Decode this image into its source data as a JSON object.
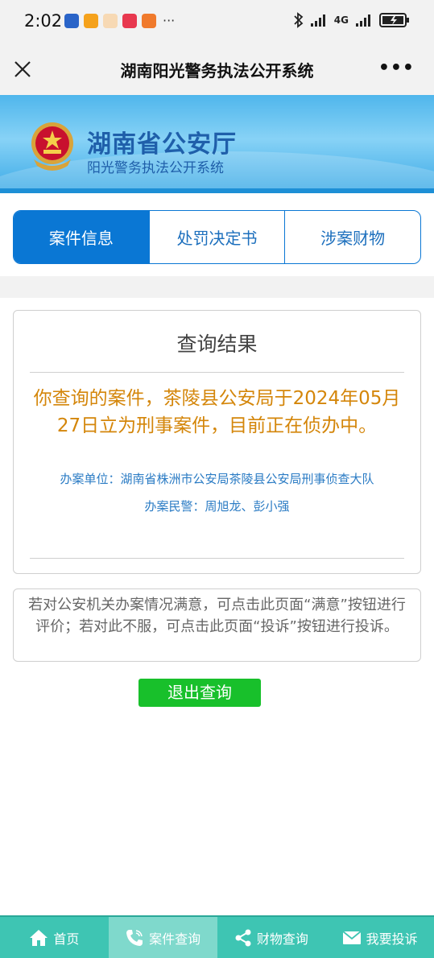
{
  "status_bar": {
    "time": "2:02",
    "network": "4G",
    "icons": [
      "bluetooth-icon",
      "wifi-icon",
      "signal-icon",
      "battery-icon"
    ],
    "more": "···"
  },
  "titlebar": {
    "title": "湖南阳光警务执法公开系统",
    "more": "•••"
  },
  "banner": {
    "title": "湖南省公安厅",
    "subtitle": "阳光警务执法公开系统"
  },
  "tabs": [
    {
      "label": "案件信息",
      "active": true
    },
    {
      "label": "处罚决定书",
      "active": false
    },
    {
      "label": "涉案财物",
      "active": false
    }
  ],
  "result": {
    "title": "查询结果",
    "message": "你查询的案件，茶陵县公安局于2024年05月27日立为刑事案件，目前正在侦办中。",
    "unit": "办案单位：湖南省株洲市公安局茶陵县公安局刑事侦查大队",
    "police": "办案民警：周旭龙、彭小强"
  },
  "notice": "若对公安机关办案情况满意，可点击此页面“满意”按钮进行评价；若对此不服，可点击此页面“投诉”按钮进行投诉。",
  "exit_button": "退出查询",
  "bottom_nav": [
    {
      "label": "首页",
      "icon": "home-icon",
      "active": false
    },
    {
      "label": "案件查询",
      "icon": "phone-icon",
      "active": true
    },
    {
      "label": "财物查询",
      "icon": "share-icon",
      "active": false
    },
    {
      "label": "我要投诉",
      "icon": "mail-icon",
      "active": false
    }
  ],
  "colors": {
    "accent": "#0a77d4",
    "result_text": "#d4860a",
    "info_text": "#2a7bc4",
    "exit_button": "#18c02b",
    "nav_bg": "#3ec5b3"
  }
}
